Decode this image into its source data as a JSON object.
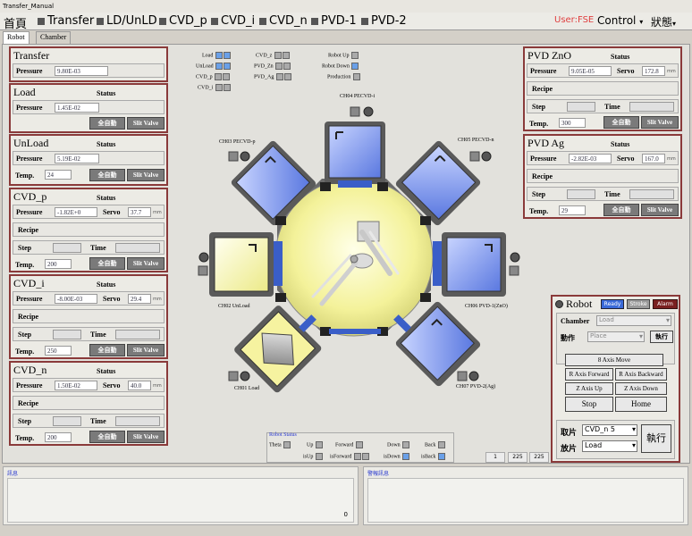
{
  "window": {
    "title": "Transfer_Manual"
  },
  "menu": {
    "items": [
      "首頁",
      "Transfer",
      "LD/UnLD",
      "CVD_p",
      "CVD_i",
      "CVD_n",
      "PVD-1",
      "PVD-2"
    ],
    "user": "User:FSE",
    "control": "Control",
    "status": "狀態"
  },
  "tabs": [
    "Robot",
    "Chamber"
  ],
  "common": {
    "status": "Status",
    "pressure": "Pressure",
    "temp": "Temp.",
    "recipe": "Recipe",
    "step": "Step",
    "time": "Time",
    "servo": "Servo",
    "auto": "全自動",
    "slit": "Slit Valve",
    "unit": "mm"
  },
  "panels": {
    "transfer": {
      "title": "Transfer",
      "pressure": "9.80E-03"
    },
    "load": {
      "title": "Load",
      "pressure": "1.45E-02"
    },
    "unload": {
      "title": "UnLoad",
      "pressure": "5.19E-02",
      "temp": "24"
    },
    "cvd_p": {
      "title": "CVD_p",
      "pressure": "-1.82E+0",
      "servo": "37.7",
      "temp": "200"
    },
    "cvd_i": {
      "title": "CVD_i",
      "pressure": "-8.00E-03",
      "servo": "29.4",
      "temp": "250"
    },
    "cvd_n": {
      "title": "CVD_n",
      "pressure": "1.50E-02",
      "servo": "40.0",
      "temp": "200"
    },
    "pvd_zno": {
      "title": "PVD ZnO",
      "pressure": "9.05E-05",
      "servo": "172.8",
      "temp": "300"
    },
    "pvd_ag": {
      "title": "PVD Ag",
      "pressure": "-2.82E-03",
      "servo": "167.0",
      "temp": "29"
    }
  },
  "legend": {
    "left": [
      "Load",
      "UnLoad",
      "CVD_p",
      "CVD_i"
    ],
    "mid": [
      "CVD_z",
      "PVD_Zn",
      "PVD_Ag"
    ],
    "right": [
      "Robot Up",
      "Robot Down",
      "Production"
    ]
  },
  "chambers": {
    "ch01": "CH01 Load",
    "ch02": "CH02 UnLoad",
    "ch03": "CH03 PECVD-p",
    "ch04": "CH04 PECVD-i",
    "ch05": "CH05 PECVD-n",
    "ch06": "CH06 PVD-1(ZnO)",
    "ch07": "CH07 PVD-2(Ag)"
  },
  "robot_status": {
    "title": "Robot Status",
    "labels": [
      "Theta",
      "Up",
      "Forward",
      "Down",
      "Back",
      "isUp",
      "isForward",
      "isDown",
      "isBack"
    ],
    "counters": [
      "1",
      "225",
      "225"
    ]
  },
  "robot": {
    "title": "Robot",
    "badges": [
      "Ready",
      "Stroke",
      "Alarm"
    ],
    "chamber_label": "Chamber",
    "chamber_value": "Load",
    "action_label": "動作",
    "action_value": "Place",
    "exec": "執行",
    "axis_move": "8 Axis Move",
    "r_fwd": "R Axis Forward",
    "r_back": "R Axis Backward",
    "z_up": "Z Axis Up",
    "z_down": "Z Axis Down",
    "stop": "Stop",
    "home": "Home",
    "pick_label": "取片",
    "pick_value": "CVD_n 5",
    "place_label": "放片",
    "place_value": "Load",
    "big_exec": "執行"
  },
  "bottom": {
    "left_title": "訊息",
    "left_value": "0",
    "right_title": "警報訊息"
  },
  "colors": {
    "panel_border": "#8a3a3a",
    "chamber_blue": "#6f8fe8",
    "center_yellow": "#f6f3a0"
  }
}
